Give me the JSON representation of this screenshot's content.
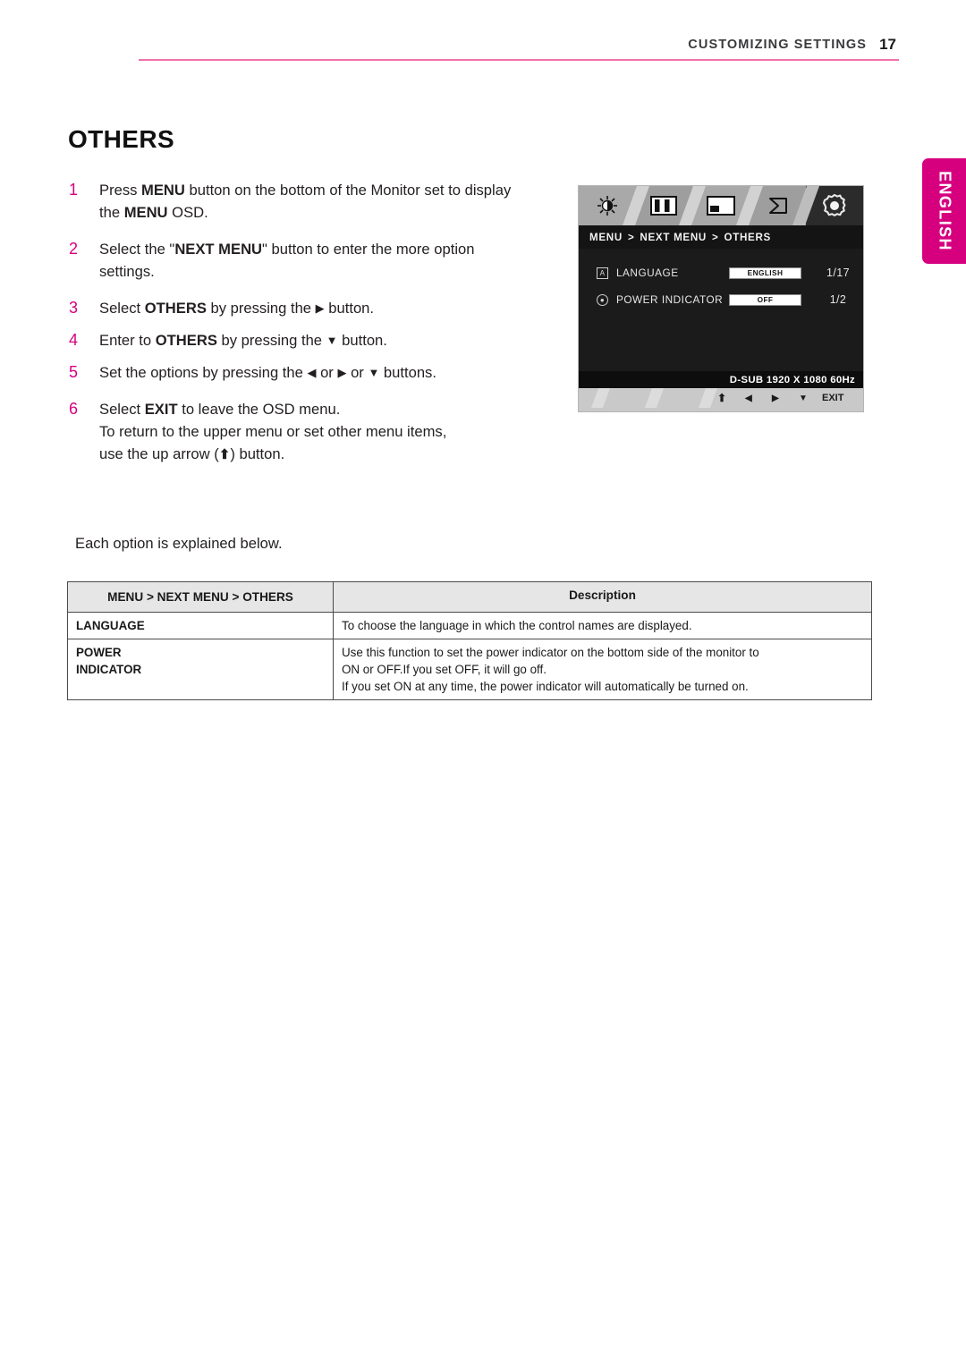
{
  "header": {
    "running_title": "CUSTOMIZING SETTINGS",
    "page_number": "17"
  },
  "language_tab": {
    "label": "ENGLISH",
    "color": "#d6007f"
  },
  "page_title": "OTHERS",
  "steps": [
    {
      "number": "1",
      "parts": [
        {
          "t": "Press ",
          "b": false
        },
        {
          "t": "MENU",
          "b": true
        },
        {
          "t": " button on the bottom of the Monitor set to display the ",
          "b": false
        },
        {
          "t": "MENU",
          "b": true
        },
        {
          "t": " OSD.",
          "b": false
        }
      ]
    },
    {
      "number": "2",
      "parts": [
        {
          "t": "Select the \"",
          "b": false
        },
        {
          "t": "NEXT MENU",
          "b": true
        },
        {
          "t": "\" button to enter the more option settings.",
          "b": false
        }
      ]
    },
    {
      "number": "3",
      "parts": [
        {
          "t": "Select ",
          "b": false
        },
        {
          "t": "OTHERS",
          "b": true
        },
        {
          "t": " by pressing the ▶ button.",
          "b": false
        }
      ]
    },
    {
      "number": "4",
      "parts": [
        {
          "t": "Enter to ",
          "b": false
        },
        {
          "t": "OTHERS",
          "b": true
        },
        {
          "t": " by pressing the ▼ button.",
          "b": false
        }
      ]
    },
    {
      "number": "5",
      "parts": [
        {
          "t": "Set the options by pressing the ◀ or ▶ or ▼ buttons.",
          "b": false
        }
      ]
    },
    {
      "number": "6",
      "parts": [
        {
          "t": "Select ",
          "b": false
        },
        {
          "t": "EXIT",
          "b": true
        },
        {
          "t": " to leave the OSD menu.",
          "b": false
        },
        {
          "t": "\nTo return to the upper menu or set other menu items, use the up arrow (⬆) button.",
          "b": false
        }
      ]
    }
  ],
  "step_texts": {
    "s1_a": "Press ",
    "s1_b1": "MENU",
    "s1_c": " button on the bottom of the Monitor set to display the ",
    "s1_b2": "MENU",
    "s1_d": " OSD.",
    "s2_a": "Select the \"",
    "s2_b1": "NEXT MENU",
    "s2_c": "\" button to enter the more option settings.",
    "s3_a": "Select ",
    "s3_b1": "OTHERS",
    "s3_c": " by pressing the ",
    "s3_arrow": "▶",
    "s3_d": " button.",
    "s4_a": "Enter to ",
    "s4_b1": "OTHERS",
    "s4_c": " by pressing the ",
    "s4_arrow": "▼",
    "s4_d": " button.",
    "s5_a": "Set the options by pressing the ",
    "s5_arrow1": "◀",
    "s5_b": " or ",
    "s5_arrow2": "▶",
    "s5_c": " or ",
    "s5_arrow3": "▼",
    "s5_d": " buttons.",
    "s6_a": "Select ",
    "s6_b1": "EXIT",
    "s6_c": " to leave the OSD menu.",
    "s6_line2": "To return to the upper menu or set other menu items,",
    "s6_line3_a": "use the up arrow (",
    "s6_uparrow": "⬆",
    "s6_line3_b": ") button."
  },
  "note": "Each option is explained below.",
  "osd": {
    "tabs": [
      {
        "name": "brightness-icon",
        "glyph": "☼"
      },
      {
        "name": "contrast-icon",
        "glyph": "contrast"
      },
      {
        "name": "picture-icon",
        "glyph": "picture"
      },
      {
        "name": "volume-icon",
        "glyph": "speaker"
      },
      {
        "name": "settings-icon",
        "glyph": "gear"
      }
    ],
    "breadcrumb": {
      "root": "MENU",
      "sep1": ">",
      "mid": "NEXT MENU",
      "sep2": ">",
      "leaf": "OTHERS"
    },
    "rows": [
      {
        "icon": "language-icon",
        "icon_glyph": "A",
        "label": "LANGUAGE",
        "value": "ENGLISH",
        "count": "1/17"
      },
      {
        "icon": "power-indicator-icon",
        "icon_glyph": "●",
        "label": "POWER INDICATOR",
        "value": "OFF",
        "count": "1/2"
      }
    ],
    "source": "D-SUB 1920 X 1080 60Hz",
    "footer": {
      "up": "⬆",
      "left": "◀",
      "right": "▶",
      "down": "▼",
      "exit": "EXIT"
    }
  },
  "table": {
    "headers": [
      "MENU > NEXT MENU > OTHERS",
      "Description"
    ],
    "rows": [
      {
        "key": "LANGUAGE",
        "key_line2": "",
        "desc": [
          "To choose the language in which the control names are displayed."
        ]
      },
      {
        "key": "POWER",
        "key_line2": "INDICATOR",
        "desc": [
          "Use this function to set the power indicator on the bottom side of the monitor to",
          "ON or OFF.If you set OFF, it will go off.",
          "If you set ON at any time, the power indicator will automatically be turned on."
        ]
      }
    ]
  }
}
